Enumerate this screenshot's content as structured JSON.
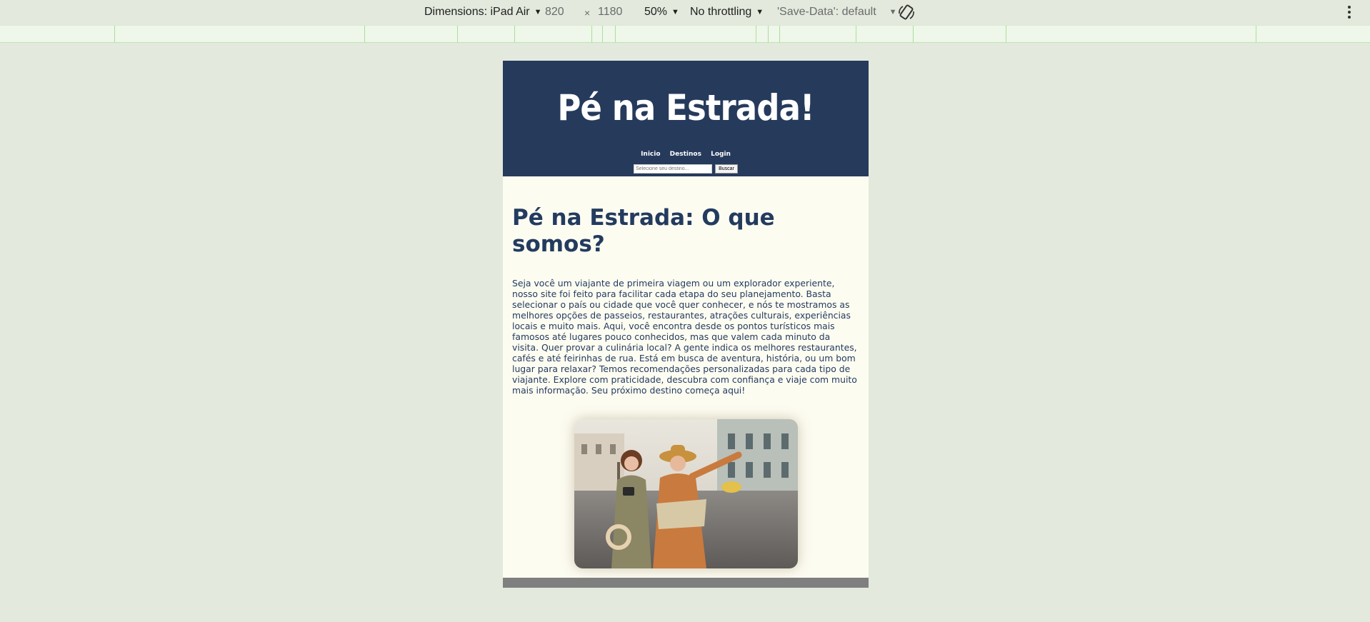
{
  "devtools": {
    "dimensions_label": "Dimensions: iPad Air",
    "width": "820",
    "times": "×",
    "height": "1180",
    "zoom": "50%",
    "throttling": "No throttling",
    "save_data": "'Save-Data': default"
  },
  "site": {
    "logo": "Pé na Estrada!",
    "nav": [
      "Inicio",
      "Destinos",
      "Login"
    ],
    "search": {
      "placeholder": "Selecione seu destino...",
      "button": "Buscar"
    },
    "heading": "Pé na Estrada: O que somos?",
    "paragraph": "Seja você um viajante de primeira viagem ou um explorador experiente, nosso site foi feito para facilitar cada etapa do seu planejamento. Basta selecionar o país ou cidade que você quer conhecer, e nós te mostramos as melhores opções de passeios, restaurantes, atrações culturais, experiências locais e muito mais. Aqui, você encontra desde os pontos turísticos mais famosos até lugares pouco conhecidos, mas que valem cada minuto da visita. Quer provar a culinária local? A gente indica os melhores restaurantes, cafés e até feirinhas de rua. Está em busca de aventura, história, ou um bom lugar para relaxar? Temos recomendações personalizadas para cada tipo de viajante. Explore com praticidade, descubra com confiança e viaje com muito mais informação. Seu próximo destino começa aqui!"
  },
  "colors": {
    "header_bg": "#263a5c",
    "page_bg": "#fdfcf1",
    "text": "#233b5f",
    "devtools_bg": "#e3e9dd"
  }
}
